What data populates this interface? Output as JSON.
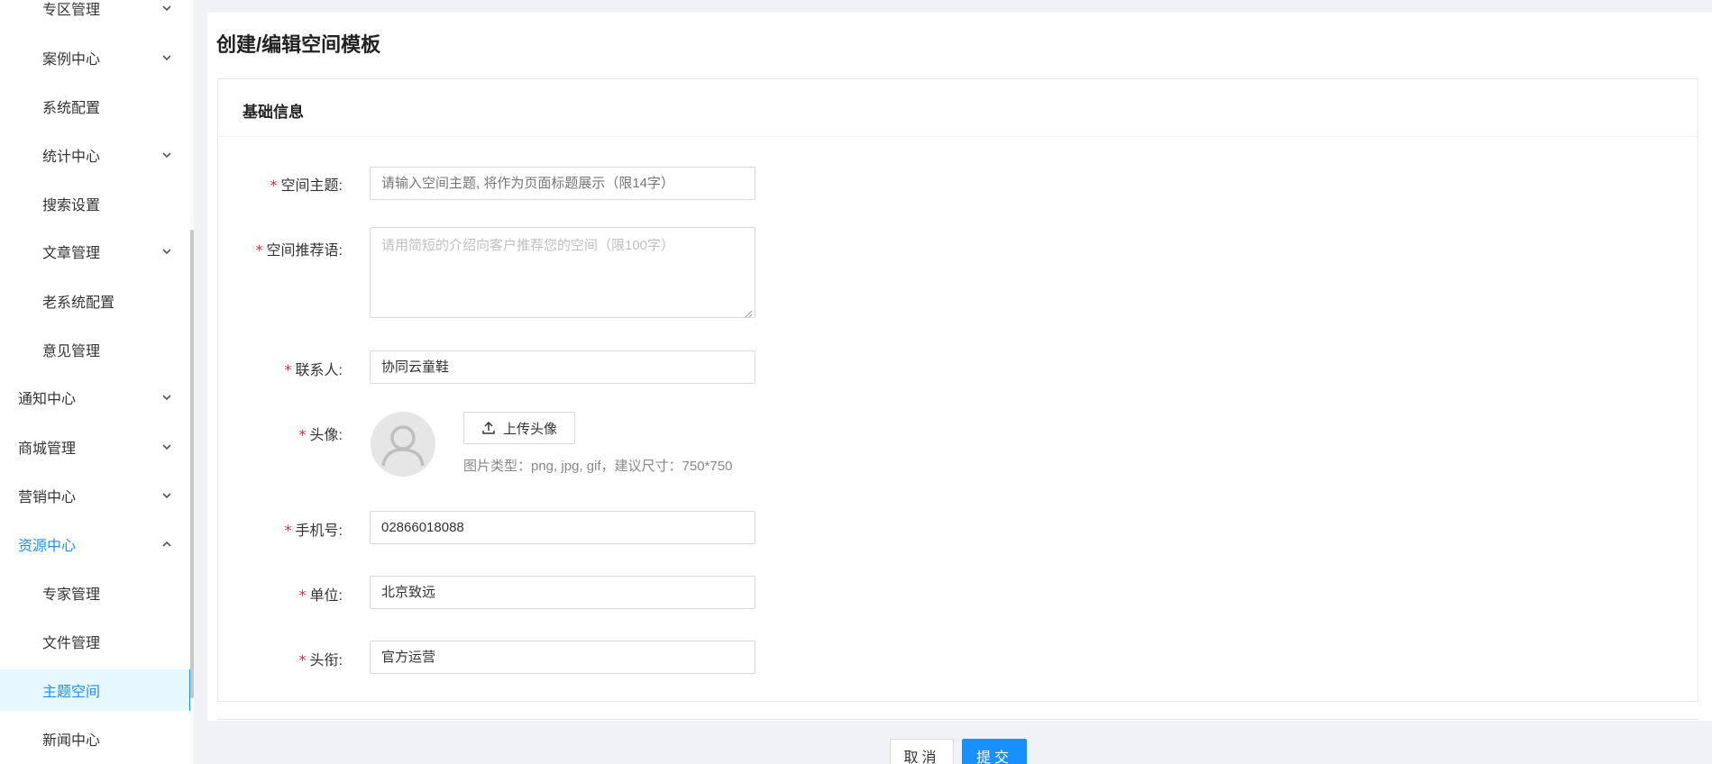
{
  "sidebar": {
    "items": [
      {
        "label": "专区管理",
        "level": "sub",
        "arrow": "chevron-down"
      },
      {
        "label": "案例中心",
        "level": "sub",
        "arrow": "chevron-down"
      },
      {
        "label": "系统配置",
        "level": "sub",
        "arrow": ""
      },
      {
        "label": "统计中心",
        "level": "sub",
        "arrow": "chevron-down"
      },
      {
        "label": "搜索设置",
        "level": "sub",
        "arrow": ""
      },
      {
        "label": "文章管理",
        "level": "sub",
        "arrow": "chevron-down"
      },
      {
        "label": "老系统配置",
        "level": "sub",
        "arrow": ""
      },
      {
        "label": "意见管理",
        "level": "sub",
        "arrow": ""
      },
      {
        "label": "通知中心",
        "level": "top",
        "arrow": "chevron-down"
      },
      {
        "label": "商城管理",
        "level": "top",
        "arrow": "chevron-down"
      },
      {
        "label": "营销中心",
        "level": "top",
        "arrow": "chevron-down"
      },
      {
        "label": "资源中心",
        "level": "top",
        "arrow": "chevron-up",
        "open": true
      },
      {
        "label": "专家管理",
        "level": "sub",
        "arrow": ""
      },
      {
        "label": "文件管理",
        "level": "sub",
        "arrow": ""
      },
      {
        "label": "主题空间",
        "level": "sub",
        "arrow": "",
        "active": true
      },
      {
        "label": "新闻中心",
        "level": "sub",
        "arrow": ""
      }
    ]
  },
  "page": {
    "title": "创建/编辑空间模板"
  },
  "form": {
    "section_title": "基础信息",
    "required_mark": "*",
    "fields": {
      "topic": {
        "label": "空间主题:",
        "value": "",
        "placeholder": "请输入空间主题, 将作为页面标题展示（限14字）"
      },
      "slogan": {
        "label": "空间推荐语:",
        "value": "",
        "placeholder": "请用简短的介绍向客户推荐您的空间（限100字）"
      },
      "contact": {
        "label": "联系人:",
        "value": "协同云童鞋"
      },
      "avatar": {
        "label": "头像:",
        "upload_label": "上传头像",
        "hint": "图片类型：png, jpg, gif，建议尺寸：750*750"
      },
      "phone": {
        "label": "手机号:",
        "value": "02866018088"
      },
      "company": {
        "label": "单位:",
        "value": "北京致远"
      },
      "title": {
        "label": "头衔:",
        "value": "官方运营"
      }
    }
  },
  "footer": {
    "cancel_label": "取消",
    "submit_label": "提交"
  },
  "colors": {
    "accent": "#1890ff",
    "required": "#f5222d"
  }
}
